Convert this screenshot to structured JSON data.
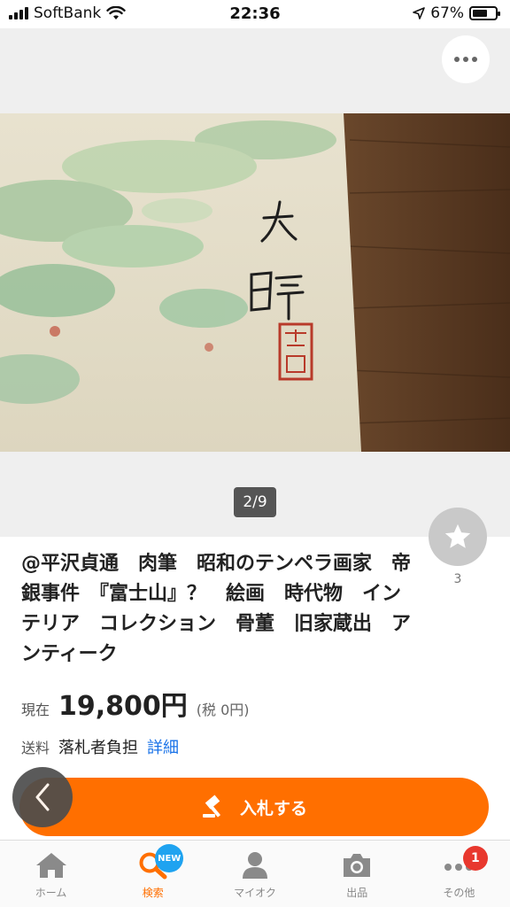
{
  "status_bar": {
    "carrier": "SoftBank",
    "time": "22:36",
    "battery_percent": "67%",
    "battery_level": 0.67
  },
  "gallery": {
    "page_indicator": "2/9",
    "photo_signature": "大暐"
  },
  "item": {
    "title": "@平沢貞通　肉筆　昭和のテンペラ画家　帝銀事件　『富士山』？　絵画　時代物　インテリア　コレクション　骨董　旧家蔵出　アンティーク",
    "watch_count": "3",
    "price_label": "現在",
    "price": "19,800円",
    "tax": "(税 0円)",
    "shipping_label": "送料",
    "shipping_value": "落札者負担",
    "shipping_detail": "詳細",
    "bid_label": "入札する"
  },
  "tabs": [
    {
      "label": "ホーム",
      "icon": "home-icon"
    },
    {
      "label": "検索",
      "icon": "search-icon",
      "badge": "NEW"
    },
    {
      "label": "マイオク",
      "icon": "person-icon"
    },
    {
      "label": "出品",
      "icon": "camera-icon"
    },
    {
      "label": "その他",
      "icon": "more-icon",
      "badge": "1"
    }
  ],
  "colors": {
    "accent": "#ff6f00",
    "link": "#1a73e8",
    "new_badge": "#1fa3f0",
    "count_badge": "#e8382e"
  }
}
